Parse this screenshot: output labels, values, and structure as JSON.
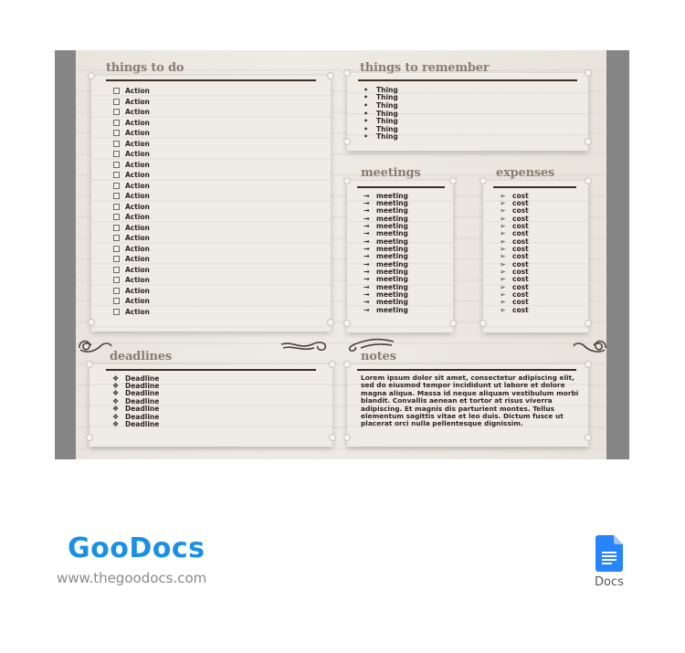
{
  "sections": {
    "todo": {
      "title": "things to do",
      "items": [
        "Action",
        "Action",
        "Action",
        "Action",
        "Action",
        "Action",
        "Action",
        "Action",
        "Action",
        "Action",
        "Action",
        "Action",
        "Action",
        "Action",
        "Action",
        "Action",
        "Action",
        "Action",
        "Action",
        "Action",
        "Action",
        "Action"
      ]
    },
    "remember": {
      "title": "things to remember",
      "bullet": "•",
      "items": [
        "Thing",
        "Thing",
        "Thing",
        "Thing",
        "Thing",
        "Thing",
        "Thing"
      ]
    },
    "meetings": {
      "title": "meetings",
      "bullet": "→",
      "items": [
        "meeting",
        "meeting",
        "meeting",
        "meeting",
        "meeting",
        "meeting",
        "meeting",
        "meeting",
        "meeting",
        "meeting",
        "meeting",
        "meeting",
        "meeting",
        "meeting",
        "meeting",
        "meeting"
      ]
    },
    "expenses": {
      "title": "expenses",
      "bullet": "➢",
      "items": [
        "cost",
        "cost",
        "cost",
        "cost",
        "cost",
        "cost",
        "cost",
        "cost",
        "cost",
        "cost",
        "cost",
        "cost",
        "cost",
        "cost",
        "cost",
        "cost"
      ]
    },
    "deadlines": {
      "title": "deadlines",
      "bullet": "❖",
      "items": [
        "Deadline",
        "Deadline",
        "Deadline",
        "Deadline",
        "Deadline",
        "Deadline",
        "Deadline"
      ]
    },
    "notes": {
      "title": "notes",
      "text": "Lorem ipsum dolor sit amet, consectetur adipiscing elit, sed do eiusmod tempor incididunt ut labore et dolore magna aliqua. Massa id neque aliquam vestibulum morbi blandit. Convallis aenean et tortor at risus viverra adipiscing. Et magnis dis parturient montes. Tellus elementum sagittis vitae et leo duis. Dictum fusce ut placerat orci nulla pellentesque dignissim."
    }
  },
  "footer": {
    "brand": "GooDocs",
    "url": "www.thegoodocs.com",
    "app_label": "Docs"
  },
  "colors": {
    "brand_blue": "#1a8fe6",
    "docs_blue": "#2684fc",
    "heading_brown": "#8a7d70",
    "rule_dark": "#3b2f26",
    "frame_gray": "#858585"
  }
}
